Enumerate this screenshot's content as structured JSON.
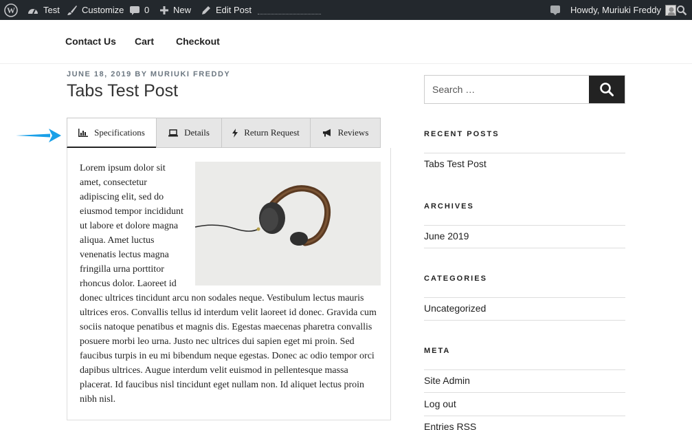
{
  "admin_bar": {
    "site_name": "Test",
    "customize": "Customize",
    "comments_count": "0",
    "new_label": "New",
    "edit_post": "Edit Post",
    "howdy": "Howdy, Muriuki Freddy"
  },
  "nav": {
    "items": [
      "Contact Us",
      "Cart",
      "Checkout"
    ]
  },
  "post": {
    "meta": "June 18, 2019 by Muriuki Freddy",
    "title": "Tabs Test Post"
  },
  "tabs": {
    "items": [
      {
        "label": "Specifications",
        "icon": "bar-chart-icon",
        "active": true
      },
      {
        "label": "Details",
        "icon": "laptop-icon",
        "active": false
      },
      {
        "label": "Return Request",
        "icon": "bolt-icon",
        "active": false
      },
      {
        "label": "Reviews",
        "icon": "megaphone-icon",
        "active": false
      }
    ],
    "content": "Lorem ipsum dolor sit amet, consectetur adipiscing elit, sed do eiusmod tempor incididunt ut labore et dolore magna aliqua. Amet luctus venenatis lectus magna fringilla urna porttitor rhoncus dolor. Laoreet id donec ultrices tincidunt arcu non sodales neque. Vestibulum lectus mauris ultrices eros. Convallis tellus id interdum velit laoreet id donec. Gravida cum sociis natoque penatibus et magnis dis. Egestas maecenas pharetra convallis posuere morbi leo urna. Justo nec ultrices dui sapien eget mi proin. Sed faucibus turpis in eu mi bibendum neque egestas. Donec ac odio tempor orci dapibus ultrices. Augue interdum velit euismod in pellentesque massa placerat. Id faucibus nisl tincidunt eget nullam non. Id aliquet lectus proin nibh nisl."
  },
  "sidebar": {
    "search_placeholder": "Search …",
    "recent_posts": {
      "title": "Recent Posts",
      "items": [
        "Tabs Test Post"
      ]
    },
    "archives": {
      "title": "Archives",
      "items": [
        "June 2019"
      ]
    },
    "categories": {
      "title": "Categories",
      "items": [
        "Uncategorized"
      ]
    },
    "meta": {
      "title": "Meta",
      "items": [
        "Site Admin",
        "Log out",
        "Entries RSS"
      ]
    }
  },
  "colors": {
    "admin_bar_bg": "#23282d",
    "arrow": "#1aa0e8",
    "search_button": "#222222"
  }
}
